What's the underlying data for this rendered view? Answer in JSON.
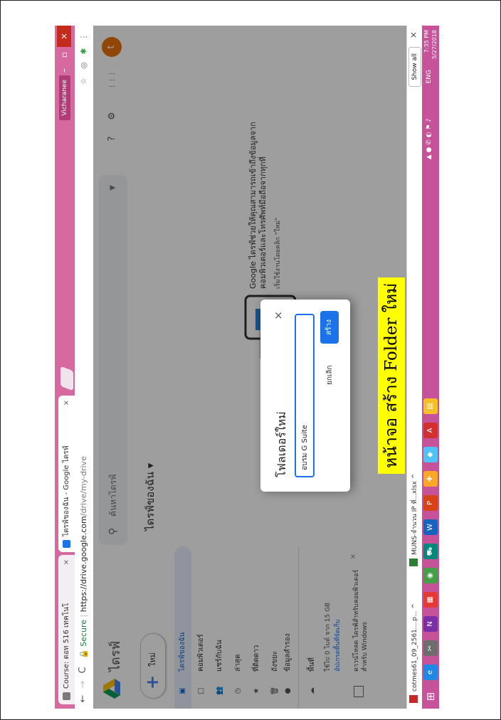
{
  "browser": {
    "tabs": [
      {
        "label": "Course: ตอท 516 เทคโนโ",
        "favicon_color": "#7a7a7a",
        "active": false
      },
      {
        "label": "ไดรฟ์ของฉัน - Google ไดรฟ์",
        "favicon_color": "#1a73e8",
        "active": true
      }
    ],
    "user_badge": "Vicharanee",
    "window_minimize": "–",
    "window_maximize": "▫",
    "window_close": "×",
    "nav_back": "←",
    "nav_forward": "→",
    "nav_reload": "C",
    "secure_label": "Secure",
    "url_host": "https://drive.google.com",
    "url_path": "/drive/my-drive",
    "star_icon": "☆"
  },
  "drive": {
    "app_title": "ไดรฟ์",
    "search_placeholder": "ค้นหาไดรฟ์",
    "new_button": "ใหม่",
    "sidebar": [
      {
        "icon": "▣",
        "label": "ไดรฟ์ของฉัน",
        "active": true
      },
      {
        "icon": "□",
        "label": "คอมพิวเตอร์",
        "active": false
      },
      {
        "icon": "👥",
        "label": "แชร์กับฉัน",
        "active": false
      },
      {
        "icon": "◷",
        "label": "ล่าสุด",
        "active": false
      },
      {
        "icon": "★",
        "label": "ที่ติดดาว",
        "active": false
      },
      {
        "icon": "🗑",
        "label": "ถังขยะ",
        "active": false
      },
      {
        "icon": "●",
        "label": "ข้อมูลสำรอง",
        "active": false
      },
      {
        "icon": "☁",
        "label": "พื้นที่",
        "active": false
      }
    ],
    "storage_text": "ใช้ไป 0 ไบต์ จาก 15 GB",
    "upgrade_link": "อัปเกรดพื้นที่จัดเก็บ",
    "promo_text": "ดาวน์โหลด ไดรฟ์สำหรับคอมพิวเตอร์ สำหรับ Windows",
    "breadcrumb": "ไดรฟ์ของฉัน ▾",
    "empty_title": "Google ไดรฟ์ช่วยให้คุณสามารถเข้าถึงข้อมูลจากคอมพิวเตอร์และโทรศัพท์มือถือจากทุกที่",
    "empty_sub": "เริ่มใช้งานโดยคลิก \"ใหม่\"",
    "header_icons": [
      "?",
      "⚙",
      "⋮⋮⋮"
    ],
    "avatar_letter": "t"
  },
  "dialog": {
    "title": "โฟลเดอร์ใหม่",
    "input_value": "อบรม G Suite",
    "cancel_label": "ยกเลิก",
    "create_label": "สร้าง",
    "close_glyph": "×"
  },
  "caption": "หน้าจอ สร้าง Folder ใหม่",
  "downloads": {
    "items": [
      {
        "label": "cotmes61_09_2561....p...   ^",
        "color": "#c62828"
      },
      {
        "label": "MUNS-จำนวน IP ที่...xlsx   ^",
        "color": "#2e7d32"
      }
    ],
    "show_all": "Show all",
    "close_glyph": "×"
  },
  "taskbar": {
    "start_glyph": "⊞",
    "apps": [
      {
        "name": "ie",
        "glyph": "e",
        "color": "#1e88e5"
      },
      {
        "name": "scissors",
        "glyph": "✂",
        "color": "#6d6d6d"
      },
      {
        "name": "onenote",
        "glyph": "N",
        "color": "#7b2fa6"
      },
      {
        "name": "grid",
        "glyph": "▦",
        "color": "#e53935"
      },
      {
        "name": "chrome",
        "glyph": "◉",
        "color": "#43a047"
      },
      {
        "name": "store",
        "glyph": "⛟",
        "color": "#00897b"
      },
      {
        "name": "word",
        "glyph": "W",
        "color": "#1565c0"
      },
      {
        "name": "powerpoint",
        "glyph": "P",
        "color": "#d84315"
      },
      {
        "name": "plugin",
        "glyph": "✚",
        "color": "#f9a825"
      },
      {
        "name": "paint",
        "glyph": "◆",
        "color": "#4fc3f7"
      },
      {
        "name": "acrobat",
        "glyph": "A",
        "color": "#d32f2f"
      },
      {
        "name": "notepad",
        "glyph": "▤",
        "color": "#f6bf26"
      }
    ],
    "lang": "ENG",
    "time": "7:35 PM",
    "date": "5/27/2018"
  }
}
